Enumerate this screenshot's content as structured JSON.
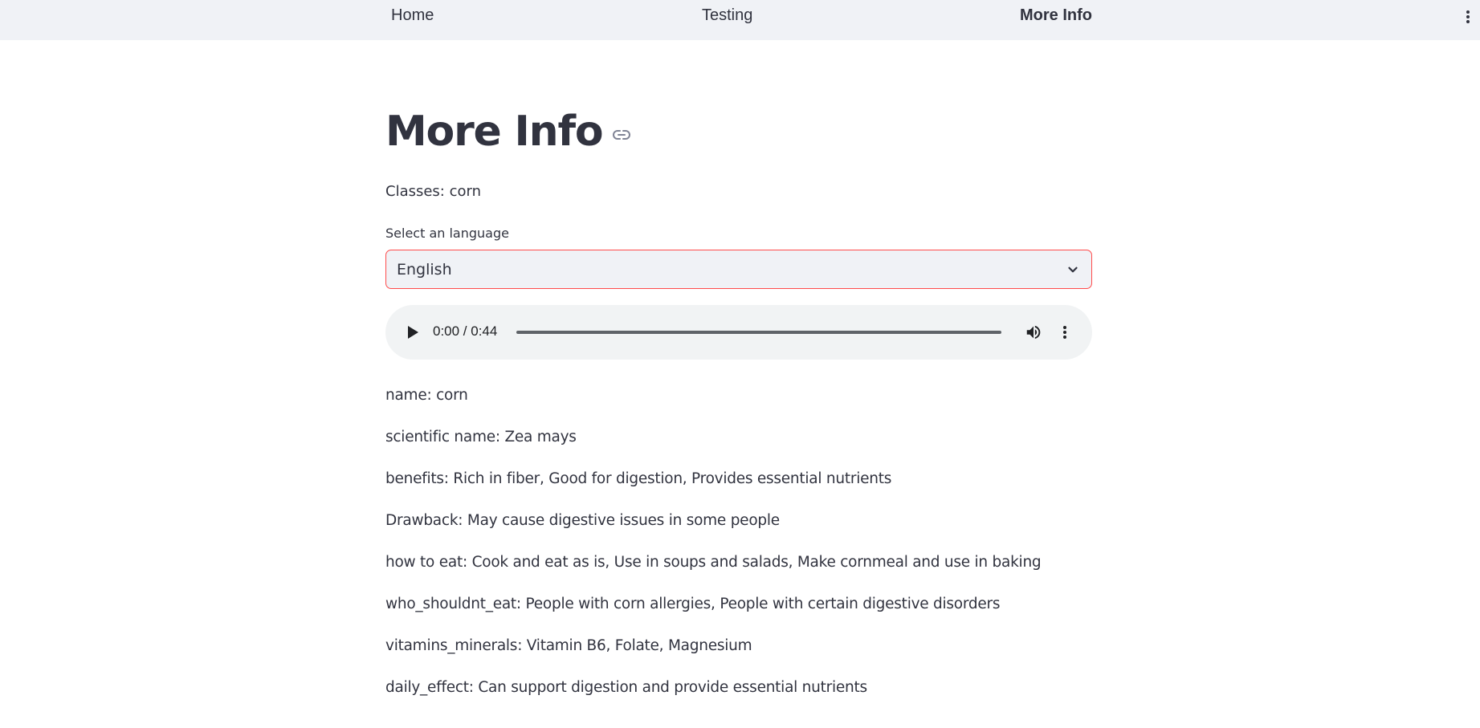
{
  "nav": {
    "items": [
      {
        "label": "Home",
        "active": false
      },
      {
        "label": "Testing",
        "active": false
      },
      {
        "label": "More Info",
        "active": true
      }
    ]
  },
  "page": {
    "title": "More Info",
    "classes_text": "Classes: corn"
  },
  "language_select": {
    "label": "Select an language",
    "value": "English"
  },
  "audio": {
    "time_display": "0:00 / 0:44",
    "progress_fraction": 0
  },
  "info": [
    "name: corn",
    "scientific name: Zea mays",
    "benefits: Rich in fiber, Good for digestion, Provides essential nutrients",
    "Drawback: May cause digestive issues in some people",
    "how to eat: Cook and eat as is, Use in soups and salads, Make cornmeal and use in baking",
    "who_shouldnt_eat: People with corn allergies, People with certain digestive disorders",
    "vitamins_minerals: Vitamin B6, Folate, Magnesium",
    "daily_effect: Can support digestion and provide essential nutrients"
  ],
  "colors": {
    "accent": "#ff4b4b",
    "nav_background": "#f0f2f6",
    "text": "#31333f"
  }
}
